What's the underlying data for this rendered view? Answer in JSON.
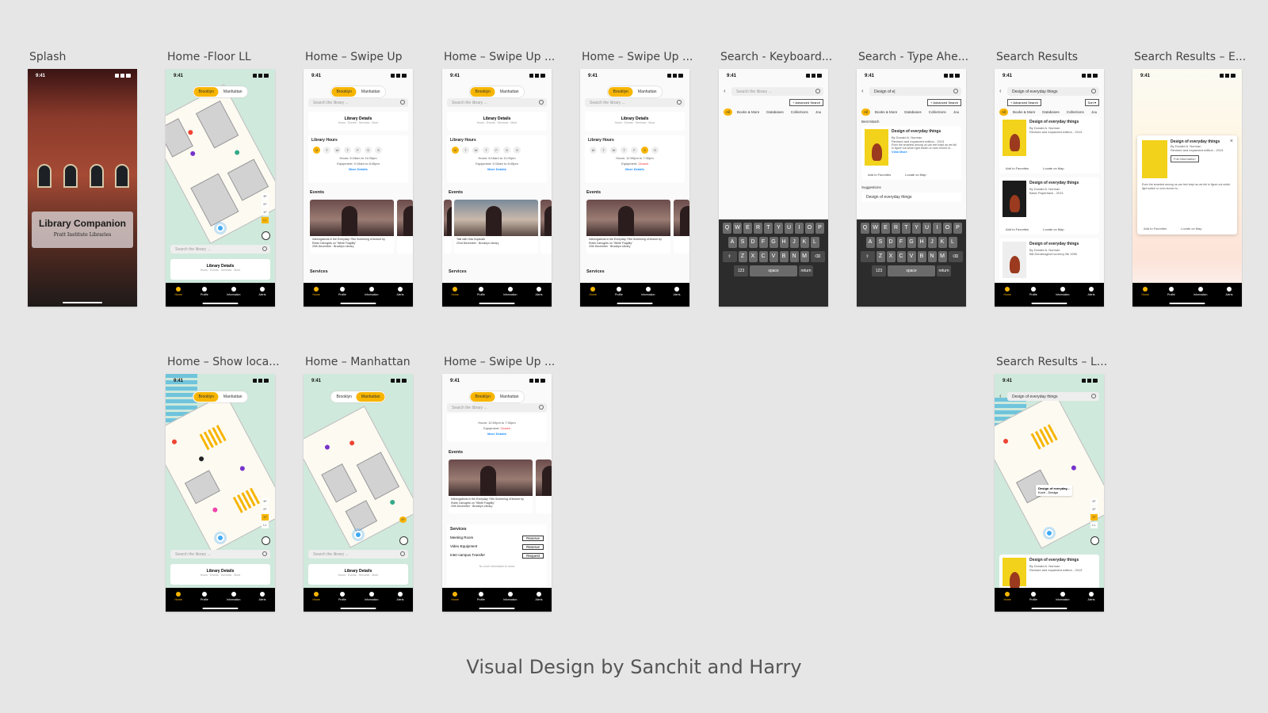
{
  "status_time": "9:41",
  "campus": {
    "brooklyn": "Brooklyn",
    "manhattan": "Manhattan"
  },
  "search_placeholder": "Search the library ...",
  "library_details": {
    "title": "Library Details",
    "sub": "Hours · Events · Services · More"
  },
  "library_hours": "Library Hours",
  "days": [
    "M",
    "T",
    "W",
    "T",
    "F",
    "S",
    "S"
  ],
  "hours_weekday": {
    "hours": "Hours: 8:15am to 11:00pm",
    "equip": "Equipment: 9:15am to 8:45pm"
  },
  "hours_weekend": {
    "hours": "Hours: 12:00pm to 7:30pm",
    "equip": "Equipment:",
    "closed": "Closed"
  },
  "more_details": "More Details",
  "events_label": "Events",
  "services_label": "Services",
  "event1": {
    "title": "Interrogations in the Everyday: Film Screening of lecture by Robin Dzhogets on \"White Fragility\"",
    "date": "20th December",
    "place": "Brooklyn Library"
  },
  "event2": {
    "title": "Talk with Gita Gopinath",
    "date": "22nd December",
    "place": "Brooklyn Library"
  },
  "services": [
    {
      "name": "Meeting Room",
      "action": "Reserve"
    },
    {
      "name": "Video Equipment",
      "action": "Reserve"
    },
    {
      "name": "Inter-campus Transfer",
      "action": "Request"
    }
  ],
  "no_more_info": "No more information to show",
  "floors": [
    "3F",
    "2F",
    "1F",
    "LL"
  ],
  "tabs": [
    "Home",
    "Profile",
    "Information",
    "Alerts"
  ],
  "frames": [
    "Splash",
    "Home -Floor LL",
    "Home – Swipe Up",
    "Home – Swipe Up ...",
    "Home – Swipe Up ...",
    "Search - Keyboard...",
    "Search - Type Ahe...",
    "Search Results",
    "Search Results – E...",
    "Home – Show loca...",
    "Home – Manhattan",
    "Home – Swipe Up ...",
    "Search Results – L..."
  ],
  "splash": {
    "title": "Library Companion",
    "subtitle": "Pratt Institute Libraries"
  },
  "search_ui": {
    "typed": "Design of e|",
    "query": "Design of everyday things",
    "advanced": "+ Advanced Search",
    "sort": "Sort",
    "chips": [
      "All",
      "Books & More",
      "Databases",
      "Collections",
      "Jou"
    ],
    "best_match": "Best Match",
    "suggestions": "Suggestions",
    "suggestion1": "Design of everyday things"
  },
  "book": {
    "title": "Design of everyday things",
    "author": "By Donald A. Norman",
    "edition": "Revised and expanded edition - 2013",
    "blurb": "Even the smartest among us can feel inept as we fail to figure out which light switch or oven burner to...",
    "view_more": "View More",
    "fav": "Add to Favorites",
    "locate": "Locate on Map",
    "full_info": "Full Information",
    "author2": "By Donald A. Norman",
    "edition2": "Basic Paperback - 2013",
    "author3": "Bill Dendridges/Currency Bk 1990",
    "map_label": "Design of everyday...",
    "map_sub": "Koch - Design"
  },
  "keyboard": {
    "row1": [
      "Q",
      "W",
      "E",
      "R",
      "T",
      "Y",
      "U",
      "I",
      "O",
      "P"
    ],
    "row2": [
      "A",
      "S",
      "D",
      "F",
      "G",
      "H",
      "J",
      "K",
      "L"
    ],
    "row3": [
      "Z",
      "X",
      "C",
      "V",
      "B",
      "N",
      "M"
    ],
    "space": "space",
    "ret": "return",
    "num": "123"
  },
  "credit": "Visual Design by Sanchit and Harry"
}
